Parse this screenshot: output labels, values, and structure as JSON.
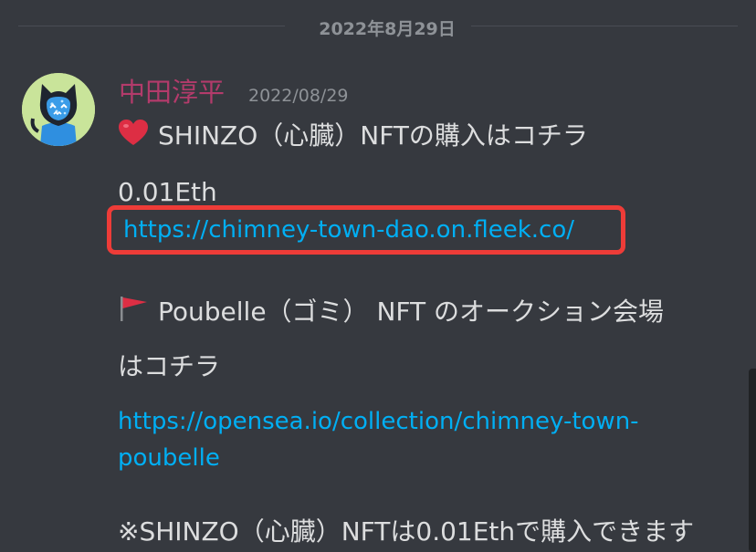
{
  "divider": {
    "date": "2022年8月29日"
  },
  "message": {
    "username": "中田淳平",
    "timestamp": "2022/08/29",
    "line1": "SHINZO（心臓）NFTの購入はコチラ",
    "price": "0.01Eth",
    "link1": "https://chimney-town-dao.on.fleek.co/",
    "line2": "Poubelle（ゴミ） NFT のオークション会場",
    "line2b": "はコチラ",
    "link2a": "https://opensea.io/collection/chimney-town-",
    "link2b": "poubelle",
    "footnote": "※SHINZO（心臓）NFTは0.01Ethで購入できます"
  },
  "icons": {
    "heart": "red-heart-icon",
    "flag": "red-flag-icon"
  },
  "colors": {
    "background": "#36393f",
    "username": "#b33b6b",
    "link": "#00aff4",
    "highlight": "#ee3c38"
  }
}
